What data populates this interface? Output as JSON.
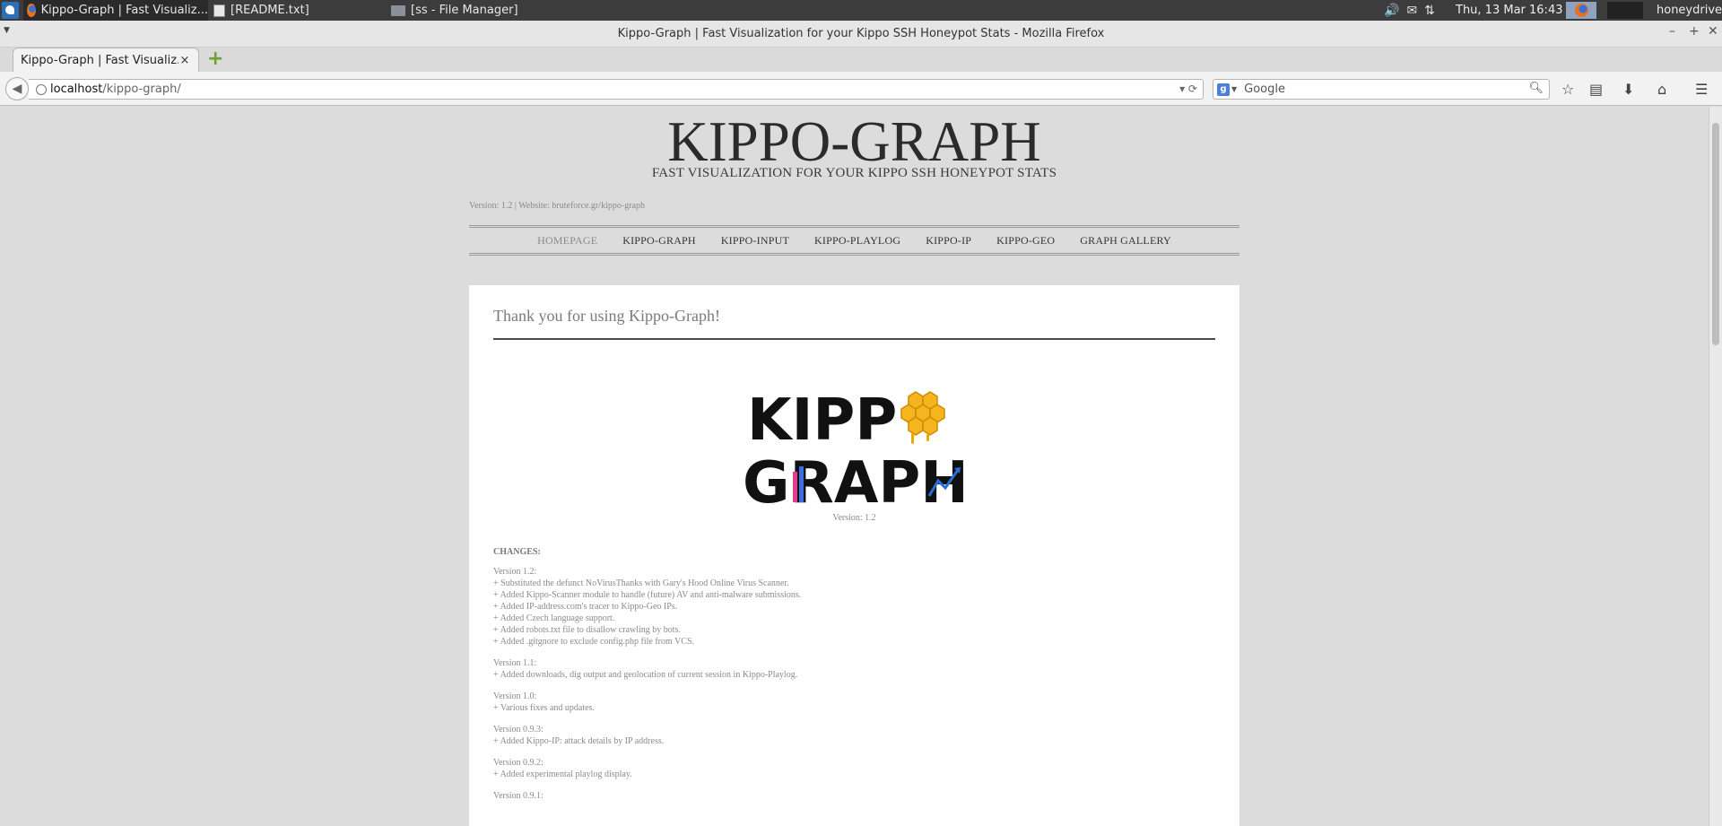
{
  "panel": {
    "tasks": [
      {
        "label": "Kippo-Graph | Fast Visualiz..."
      },
      {
        "label": "[README.txt]"
      },
      {
        "label": "[ss - File Manager]"
      }
    ],
    "clock": "Thu, 13 Mar  16:43",
    "user": "honeydrive"
  },
  "window": {
    "title": "Kippo-Graph | Fast Visualization for your Kippo SSH Honeypot Stats - Mozilla Firefox"
  },
  "tab": {
    "title": "Kippo-Graph | Fast Visualiz...",
    "close": "×"
  },
  "url": {
    "host": "localhost",
    "path": "/kippo-graph/"
  },
  "search": {
    "engine": "Google"
  },
  "site": {
    "title": "KIPPO-GRAPH",
    "subtitle": "FAST VISUALIZATION FOR YOUR KIPPO SSH HONEYPOT STATS",
    "version_line": "Version: 1.2 | Website: bruteforce.gr/kippo-graph",
    "menu": [
      {
        "label": "HOMEPAGE",
        "current": true
      },
      {
        "label": "KIPPO-GRAPH"
      },
      {
        "label": "KIPPO-INPUT"
      },
      {
        "label": "KIPPO-PLAYLOG"
      },
      {
        "label": "KIPPO-IP"
      },
      {
        "label": "KIPPO-GEO"
      },
      {
        "label": "GRAPH GALLERY"
      }
    ]
  },
  "content": {
    "heading": "Thank you for using Kippo-Graph!",
    "logo_text": [
      "KIPP",
      "GRAPH"
    ],
    "version": "Version: 1.2",
    "changes_title": "CHANGES:",
    "changelog": [
      {
        "version": "Version 1.2:",
        "items": [
          "+ Substituted the defunct NoVirusThanks with Gary's Hood Online Virus Scanner.",
          "+ Added Kippo-Scanner module to handle (future) AV and anti-malware submissions.",
          "+ Added IP-address.com's tracer to Kippo-Geo IPs.",
          "+ Added Czech language support.",
          "+ Added robots.txt file to disallow crawling by bots.",
          "+ Added .gitgnore to exclude config.php file from VCS."
        ]
      },
      {
        "version": "Version 1.1:",
        "items": [
          "+ Added downloads, dig output and geolocation of current session in Kippo-Playlog."
        ]
      },
      {
        "version": "Version 1.0:",
        "items": [
          "+ Various fixes and updates."
        ]
      },
      {
        "version": "Version 0.9.3:",
        "items": [
          "+ Added Kippo-IP: attack details by IP address."
        ]
      },
      {
        "version": "Version 0.9.2:",
        "items": [
          "+ Added experimental playlog display."
        ]
      },
      {
        "version": "Version 0.9.1:",
        "items": []
      }
    ]
  }
}
